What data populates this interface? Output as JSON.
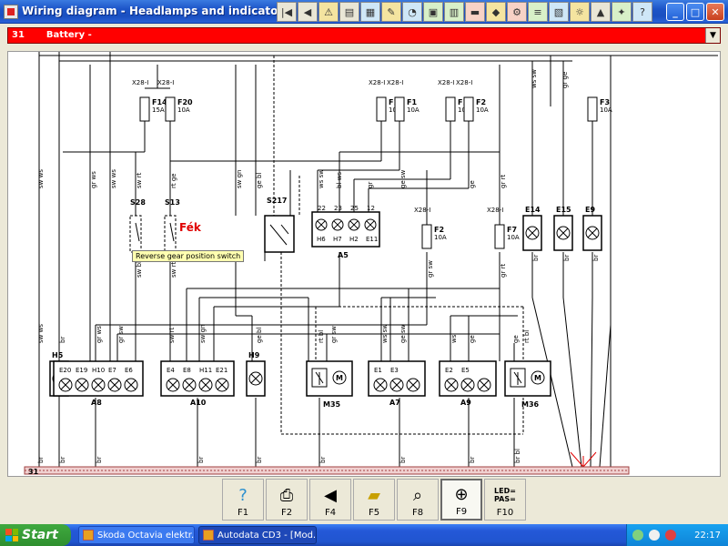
{
  "window": {
    "title": "Wiring diagram - Headlamps and indicators",
    "minimize": "_",
    "maximize": "□",
    "close": "✕"
  },
  "toolbar_icons": [
    "first-icon",
    "prev-icon",
    "warning-icon",
    "document-icon",
    "map-icon",
    "tools-icon",
    "gauge-icon",
    "image-icon",
    "grid-icon",
    "battery-icon",
    "car-icon",
    "engine-icon",
    "signal-icon",
    "chart-icon",
    "lamp-icon",
    "rocket-icon",
    "settings-icon",
    "help-icon"
  ],
  "circuit_select": {
    "number": "31",
    "value": "Battery -"
  },
  "diagram": {
    "top_fuses": [
      {
        "conn": "X28-I",
        "name": "F14",
        "rating": "15A"
      },
      {
        "conn": "X28-I",
        "name": "F20",
        "rating": "10A"
      },
      {
        "conn": "X28-I",
        "name": "F11",
        "rating": "10A"
      },
      {
        "conn": "X28-I",
        "name": "F1",
        "rating": "10A"
      },
      {
        "conn": "X28-I",
        "name": "F12",
        "rating": "10A"
      },
      {
        "conn": "X28-I",
        "name": "F2",
        "rating": "10A"
      },
      {
        "conn": "",
        "name": "F3",
        "rating": "10A"
      }
    ],
    "mid_fuses": [
      {
        "conn": "X28-I",
        "name": "F2",
        "rating": "10A"
      },
      {
        "conn": "X28-I",
        "name": "F7",
        "rating": "10A"
      }
    ],
    "switches": [
      "S28",
      "S13",
      "S217"
    ],
    "mid_lamps": [
      "E14",
      "E15",
      "E9"
    ],
    "a5": {
      "name": "A5",
      "pins": [
        "22",
        "23",
        "25",
        "12"
      ],
      "lamps": [
        "H6",
        "H7",
        "H2",
        "E11"
      ]
    },
    "bottom_lamps": [
      "H5",
      "H9"
    ],
    "a8": {
      "name": "A8",
      "lamps": [
        "E20",
        "E19",
        "H10",
        "E7",
        "E6"
      ]
    },
    "a10": {
      "name": "A10",
      "lamps": [
        "E4",
        "E8",
        "H11",
        "E21"
      ]
    },
    "a7": {
      "name": "A7",
      "lamps": [
        "E1",
        "E3"
      ]
    },
    "a9": {
      "name": "A9",
      "lamps": [
        "E2",
        "E5"
      ]
    },
    "motors": [
      "M35",
      "M36"
    ],
    "ground_label": "31",
    "tooltip": "Reverse gear position switch",
    "fek_label": "Fék"
  },
  "fkeys": [
    {
      "label": "F1",
      "icon": "help-icon"
    },
    {
      "label": "F2",
      "icon": "printer-icon"
    },
    {
      "label": "F4",
      "icon": "back-icon"
    },
    {
      "label": "F5",
      "icon": "car-icon"
    },
    {
      "label": "F8",
      "icon": "magnifier-icon"
    },
    {
      "label": "F9",
      "icon": "zoom-icon",
      "active": true
    },
    {
      "label": "F10",
      "icon": "led-icon",
      "icon_text": "LED=\nPAS="
    }
  ],
  "taskbar": {
    "start": "Start",
    "tasks": [
      "Skoda Octavia elektr...",
      "Autodata CD3 - [Mod..."
    ],
    "lang": "HU",
    "clock": "22:17"
  }
}
